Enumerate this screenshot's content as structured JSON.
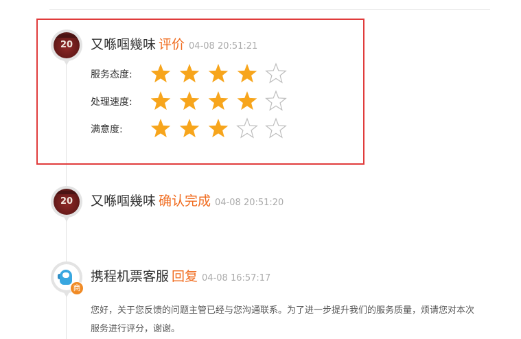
{
  "colors": {
    "accent": "#f06b1e",
    "star_filled": "#f7a51c",
    "star_empty": "#bdbdbd",
    "highlight_border": "#e03b3b"
  },
  "entries": [
    {
      "name": "又喺啯幾味",
      "action": "评价",
      "time": "04-08 20:51:21",
      "avatar": "jersey-avatar-icon",
      "ratings": [
        {
          "label": "服务态度:",
          "stars": 4,
          "max": 5
        },
        {
          "label": "处理速度:",
          "stars": 4,
          "max": 5
        },
        {
          "label": "满意度:",
          "stars": 3,
          "max": 5
        }
      ]
    },
    {
      "name": "又喺啯幾味",
      "action": "确认完成",
      "time": "04-08 20:51:20",
      "avatar": "jersey-avatar-icon"
    },
    {
      "name": "携程机票客服",
      "action": "回复",
      "time": "04-08 16:57:17",
      "avatar": "service-bot-avatar-icon",
      "badge": "商",
      "message": "您好，关于您反馈的问题主管已经与您沟通联系。为了进一步提升我们的服务质量，烦请您对本次服务进行评分，谢谢。"
    }
  ]
}
